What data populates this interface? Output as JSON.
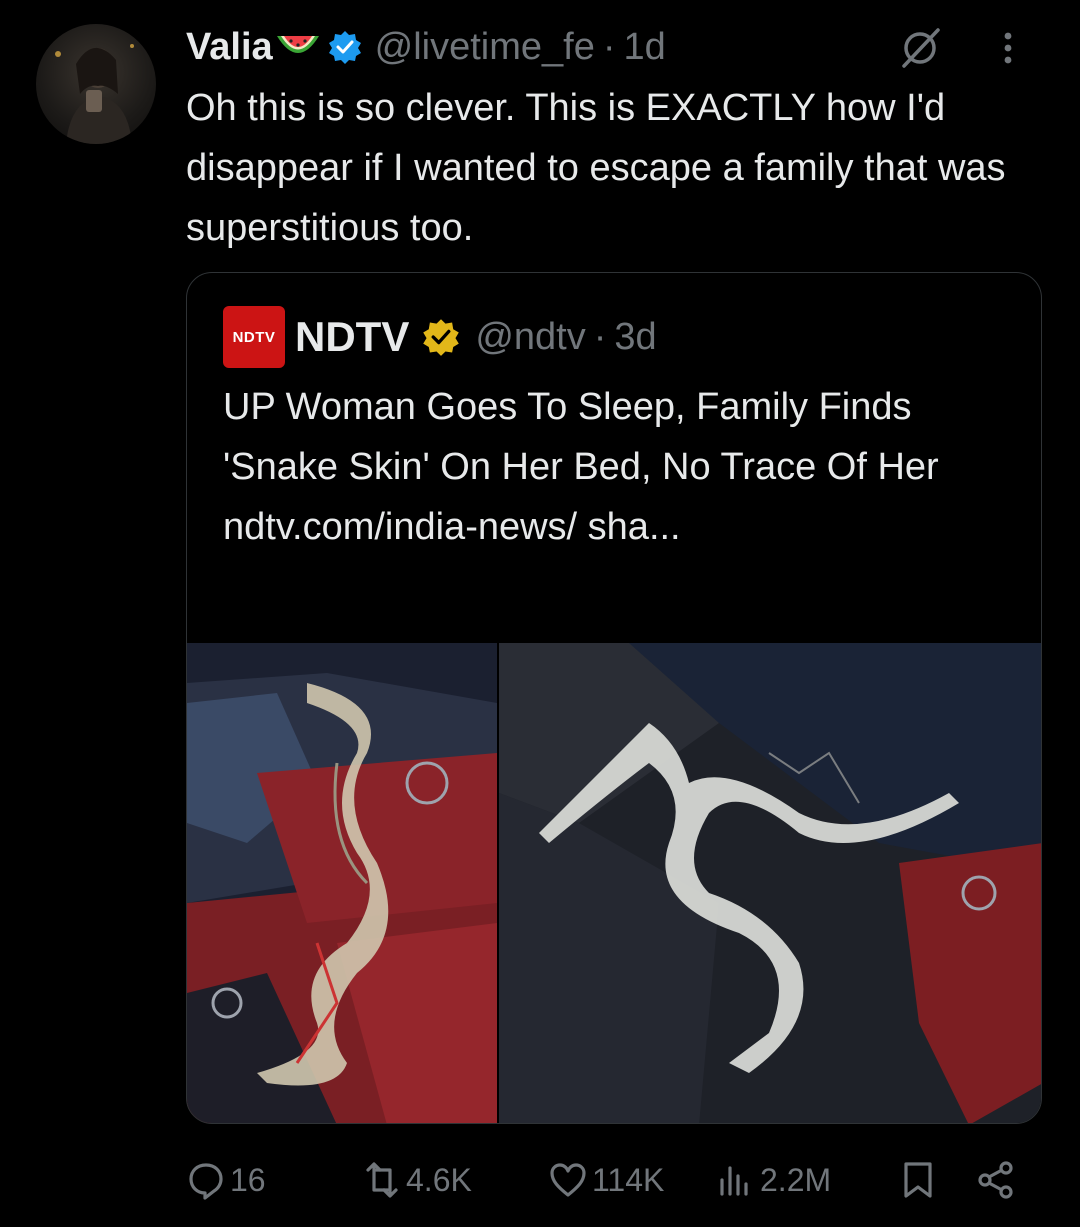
{
  "tweet": {
    "author_name": "Valia",
    "handle": "@livetime_fe",
    "separator": "·",
    "time": "1d",
    "text": "Oh this is so clever. This is EXACTLY how I'd disappear if I wanted to escape a family that was superstitious too."
  },
  "quote": {
    "logo_text": "NDTV",
    "name": "NDTV",
    "handle": "@ndtv",
    "separator": "·",
    "time": "3d",
    "text": "UP Woman Goes To Sleep, Family Finds 'Snake Skin' On Her Bed, No Trace Of Her ndtv.com/india-news/ sha..."
  },
  "actions": {
    "replies": "16",
    "reposts": "4.6K",
    "likes": "114K",
    "views": "2.2M"
  },
  "colors": {
    "background": "#000000",
    "text": "#e7e9ea",
    "muted": "#71767b",
    "verified_blue": "#1d9bf0",
    "verified_gold": "#e2b719",
    "ndtv_red": "#cc1414",
    "border": "#2f3336"
  },
  "icons": [
    "watermelon-icon",
    "verified-badge-icon",
    "grok-icon",
    "more-icon",
    "reply-icon",
    "repost-icon",
    "like-icon",
    "views-icon",
    "bookmark-icon",
    "share-icon"
  ]
}
